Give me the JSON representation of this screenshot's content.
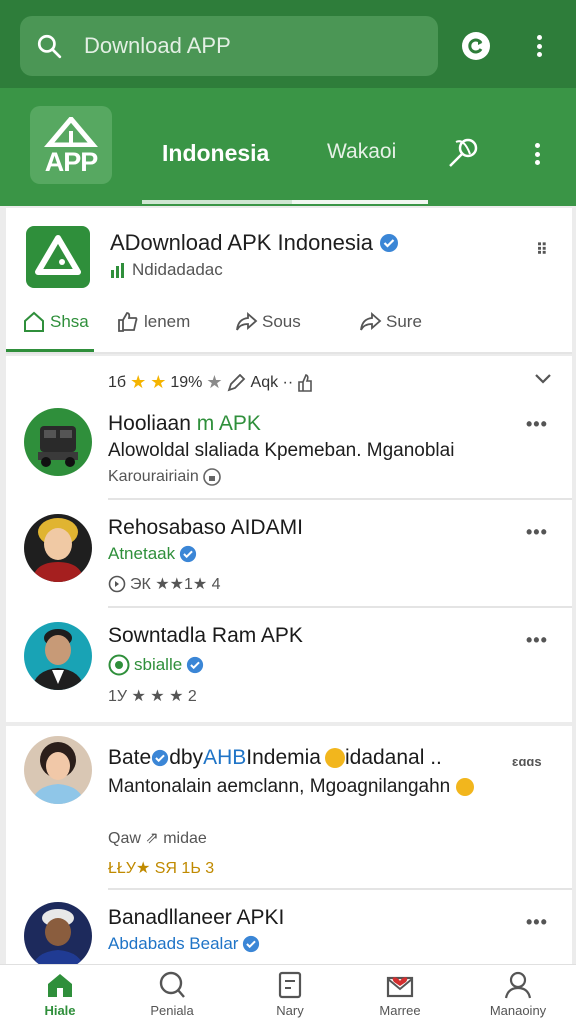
{
  "search": {
    "placeholder": "Download APP"
  },
  "colors": {
    "primary": "#2e7d3a",
    "header": "#3a9546",
    "accent": "#2f8f3b",
    "verified": "#1f74c7",
    "star": "#f5b400"
  },
  "icons": {
    "search": "search-icon",
    "refresh": "refresh-icon",
    "more": "more-vert-icon"
  },
  "header": {
    "logo_text": "APP",
    "tabs": [
      {
        "label": "Indonesia",
        "active": true
      },
      {
        "label": "Wakaoi",
        "active": false
      }
    ]
  },
  "app_card": {
    "title": "ADownload APK Indonesia",
    "subtitle": "Ndidadadac",
    "menu": "⠿",
    "actions": [
      {
        "label": "Shsa"
      },
      {
        "label": "lenem"
      },
      {
        "label": "Sous"
      },
      {
        "label": "Sure"
      }
    ]
  },
  "feed": {
    "stats": {
      "count": "1б",
      "percent": "19%",
      "label": "Aqk ··"
    },
    "items": [
      {
        "name_prefix": "Hooliaan ",
        "name_highlight": "m APK",
        "line2": "Alowoldal slaliada Kpemeban. Mganoblai",
        "line3": "Karourairiain"
      },
      {
        "name": "Rehosabaso AIDAMI",
        "line2": "Atnetaak",
        "line3": "ЭК ★★1★ 4"
      },
      {
        "name": "Sowntadla Ram APK",
        "line2": "sbialle",
        "line3": "1У ★ ★ ★ 2"
      }
    ]
  },
  "feed2": {
    "items": [
      {
        "name_a": "Bate ",
        "name_b": "dby ",
        "name_c": "AHB",
        "name_d": " Indemia",
        "name_e": " idadanal ..",
        "menu": "ɛɑɑs",
        "line2": "Mantonalain aemclann, Mgoagnilangahn",
        "meta": "Qaw  ⇗ midae",
        "line3": "ŁŁУ★ ЅЯ 1Ь 3"
      },
      {
        "name": "Banadllaneer APKI",
        "line2": "Abdabads Bealar"
      }
    ]
  },
  "bottom_nav": [
    {
      "label": "Hiale",
      "active": true
    },
    {
      "label": "Peniala",
      "active": false
    },
    {
      "label": "Nary",
      "active": false
    },
    {
      "label": "Marree",
      "active": false
    },
    {
      "label": "Manaoiny",
      "active": false
    }
  ]
}
